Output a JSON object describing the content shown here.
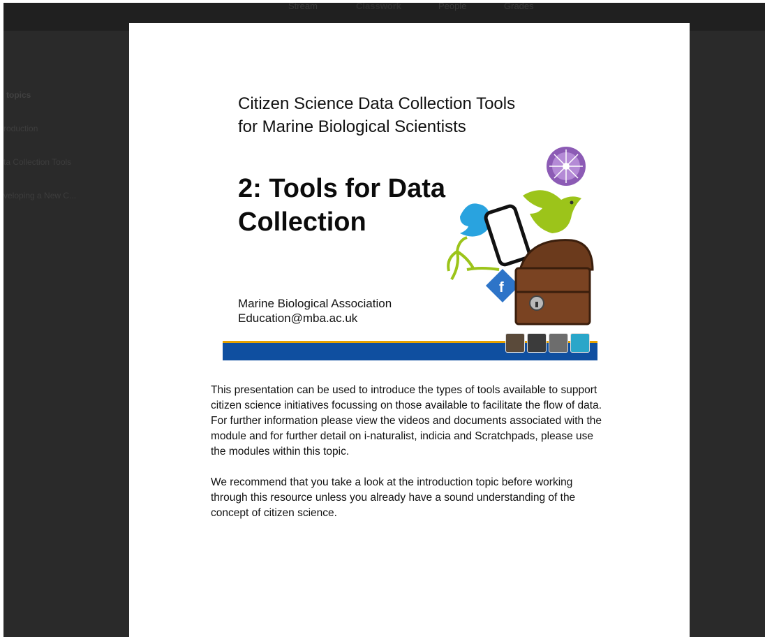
{
  "tabs": [
    {
      "label": "Stream"
    },
    {
      "label": "Classwork"
    },
    {
      "label": "People"
    },
    {
      "label": "Grades"
    }
  ],
  "sidebar": {
    "header": "topics",
    "items": [
      {
        "label": "roduction"
      },
      {
        "label": "ta Collection Tools"
      },
      {
        "label": "veloping a New C..."
      }
    ]
  },
  "slide": {
    "subtitle_line1": "Citizen Science Data Collection Tools",
    "subtitle_line2": "for Marine Biological Scientists",
    "title_line1": "2: Tools for Data",
    "title_line2": "Collection",
    "org_line1": "Marine Biological Association",
    "org_line2": "Education@mba.ac.uk"
  },
  "description": {
    "para1": "This presentation can be used to introduce the types of tools available to support citizen science initiatives focussing on those available to facilitate the flow of data. For further information please view the videos and documents associated with the module and for further detail on i-naturalist, indicia and Scratchpads, please use the modules within this topic.",
    "para2": "We recommend that you take a look at the introduction topic before working through this resource unless you already have a sound understanding of the concept of citizen science."
  },
  "colors": {
    "bar": "#0f4fa0",
    "bar_stripe": "#e6a100",
    "twitter": "#29a3df",
    "bird": "#9cc41a",
    "chest": "#6b3a1c",
    "facebook": "#2d74c8"
  },
  "icons": [
    "twitter-bird-icon",
    "smartphone-icon",
    "green-bird-icon",
    "treasure-chest-icon",
    "facebook-icon",
    "sea-urchin-icon",
    "plant-icon"
  ]
}
